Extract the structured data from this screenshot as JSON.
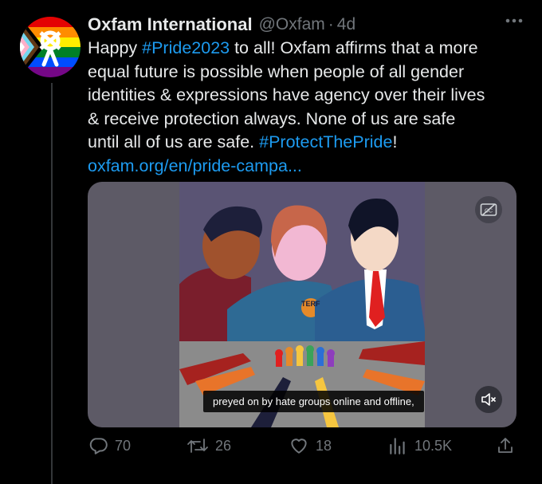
{
  "tweet": {
    "display_name": "Oxfam International",
    "handle": "@Oxfam",
    "separator": "·",
    "time": "4d",
    "text_lines": [
      [
        {
          "t": "Happy ",
          "link": false
        },
        {
          "t": "#Pride2023",
          "link": true
        },
        {
          "t": " to all! Oxfam affirms that a more",
          "link": false
        }
      ],
      [
        {
          "t": "equal future is possible when people of all gender",
          "link": false
        }
      ],
      [
        {
          "t": "identities & expressions have agency over their lives",
          "link": false
        }
      ],
      [
        {
          "t": "& receive protection always. None of us are safe",
          "link": false
        }
      ],
      [
        {
          "t": "until all of us are safe. ",
          "link": false
        },
        {
          "t": "#ProtectThePride",
          "link": true
        },
        {
          "t": "!",
          "link": false
        }
      ],
      [
        {
          "t": "oxfam.org/en/pride-campa...",
          "link": true
        }
      ]
    ],
    "media": {
      "caption": "preyed on by hate groups online and offline,",
      "badge_text": "TERF"
    },
    "stats": {
      "replies": "70",
      "retweets": "26",
      "likes": "18",
      "views": "10.5K"
    }
  },
  "colors": {
    "link": "#1d9bf0",
    "muted": "#71767b",
    "text": "#e7e9ea",
    "background": "#000000"
  },
  "icons": [
    "oxfam-logo-icon",
    "more-icon",
    "cc-icon",
    "mute-icon",
    "reply-icon",
    "retweet-icon",
    "like-icon",
    "views-icon",
    "share-icon"
  ]
}
